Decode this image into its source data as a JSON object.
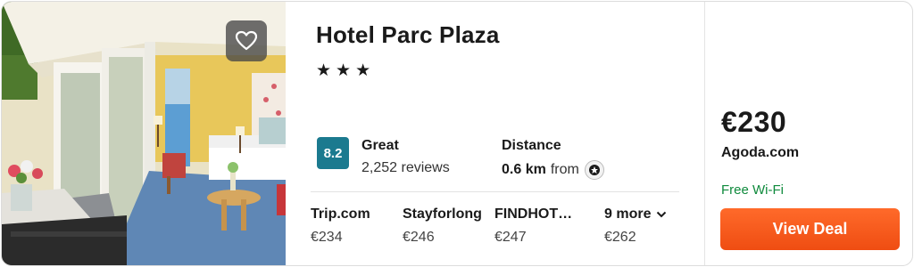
{
  "hotel": {
    "name": "Hotel Parc Plaza",
    "stars": "★★★"
  },
  "rating": {
    "score": "8.2",
    "label": "Great",
    "reviews": "2,252 reviews",
    "badge_color": "#1b7a8f"
  },
  "distance": {
    "label": "Distance",
    "value": "0.6 km",
    "suffix": "from",
    "icon": "landmark-icon"
  },
  "providers": [
    {
      "name": "Trip.com",
      "price": "€234"
    },
    {
      "name": "Stayforlong",
      "price": "€246"
    },
    {
      "name": "FINDHOT…",
      "price": "€247"
    }
  ],
  "more": {
    "label": "9 more",
    "price": "€262"
  },
  "deal": {
    "price": "€230",
    "site": "Agoda.com",
    "amenity": "Free Wi-Fi",
    "button": "View Deal",
    "accent": "#f05a1c"
  },
  "favorite": {
    "icon": "heart-icon"
  }
}
